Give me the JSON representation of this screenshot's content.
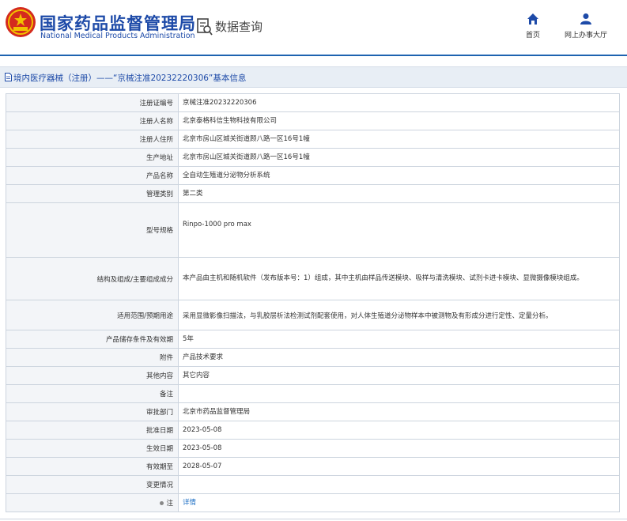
{
  "header": {
    "site_title": "国家药品监督管理局",
    "site_subtitle": "National Medical Products Administration",
    "query_label": "数据查询",
    "nav": [
      {
        "label": "首页",
        "icon": "home-icon"
      },
      {
        "label": "网上办事大厅",
        "icon": "user-icon"
      }
    ]
  },
  "crumb": "境内医疗器械（注册）——“京械注准20232220306”基本信息",
  "rows": [
    {
      "label": "注册证编号",
      "value": "京械注准20232220306"
    },
    {
      "label": "注册人名称",
      "value": "北京泰格科信生物科技有限公司"
    },
    {
      "label": "注册人住所",
      "value": "北京市房山区城关街道顾八路一区16号1幢"
    },
    {
      "label": "生产地址",
      "value": "北京市房山区城关街道顾八路一区16号1幢"
    },
    {
      "label": "产品名称",
      "value": "全自动生殖道分泌物分析系统"
    },
    {
      "label": "管理类别",
      "value": "第二类"
    },
    {
      "label": "型号规格",
      "value": "Rinpo-1000 pro max"
    },
    {
      "label": "结构及组成/主要组成成分",
      "value": "本产品由主机和随机软件（发布版本号：1）组成，其中主机由样品传送模块、吸样与清洗模块、试剂卡进卡模块、显微摄像模块组成。"
    },
    {
      "label": "适用范围/预期用途",
      "value": "采用显微影像扫描法，与乳胶层析法检测试剂配套使用，对人体生殖道分泌物样本中被测物及有形成分进行定性、定量分析。"
    },
    {
      "label": "产品储存条件及有效期",
      "value": "5年"
    },
    {
      "label": "附件",
      "value": "产品技术要求"
    },
    {
      "label": "其他内容",
      "value": "其它内容"
    },
    {
      "label": "备注",
      "value": ""
    },
    {
      "label": "审批部门",
      "value": "北京市药品监督管理局"
    },
    {
      "label": "批准日期",
      "value": "2023-05-08"
    },
    {
      "label": "生效日期",
      "value": "2023-05-08"
    },
    {
      "label": "有效期至",
      "value": "2028-05-07"
    },
    {
      "label": "变更情况",
      "value": ""
    },
    {
      "label": "注",
      "value": "详情"
    }
  ],
  "colors": {
    "brand": "#1d4aa8",
    "link": "#1d6fc4",
    "label_bg": "#f3f5f8",
    "crumb_bg": "#e8eef5"
  }
}
